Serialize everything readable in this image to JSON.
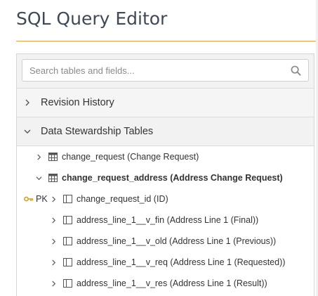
{
  "header": {
    "title": "SQL Query Editor"
  },
  "search": {
    "placeholder": "Search tables and fields..."
  },
  "sections": [
    {
      "label": "Revision History",
      "expanded": false
    },
    {
      "label": "Data Stewardship Tables",
      "expanded": true
    }
  ],
  "tables": [
    {
      "label": "change_request (Change Request)",
      "expanded": false
    },
    {
      "label": "change_request_address (Address Change Request)",
      "expanded": true
    }
  ],
  "fields": [
    {
      "label": "change_request_id (ID)",
      "pk": "PK"
    },
    {
      "label": "address_line_1__v_fin (Address Line 1 (Final))"
    },
    {
      "label": "address_line_1__v_old (Address Line 1 (Previous))"
    },
    {
      "label": "address_line_1__v_req (Address Line 1 (Requested))"
    },
    {
      "label": "address_line_1__v_res (Address Line 1 (Result))"
    }
  ],
  "colors": {
    "accent_rule": "#d9a441",
    "key_icon": "#d4a017",
    "title": "#3d4a56"
  }
}
